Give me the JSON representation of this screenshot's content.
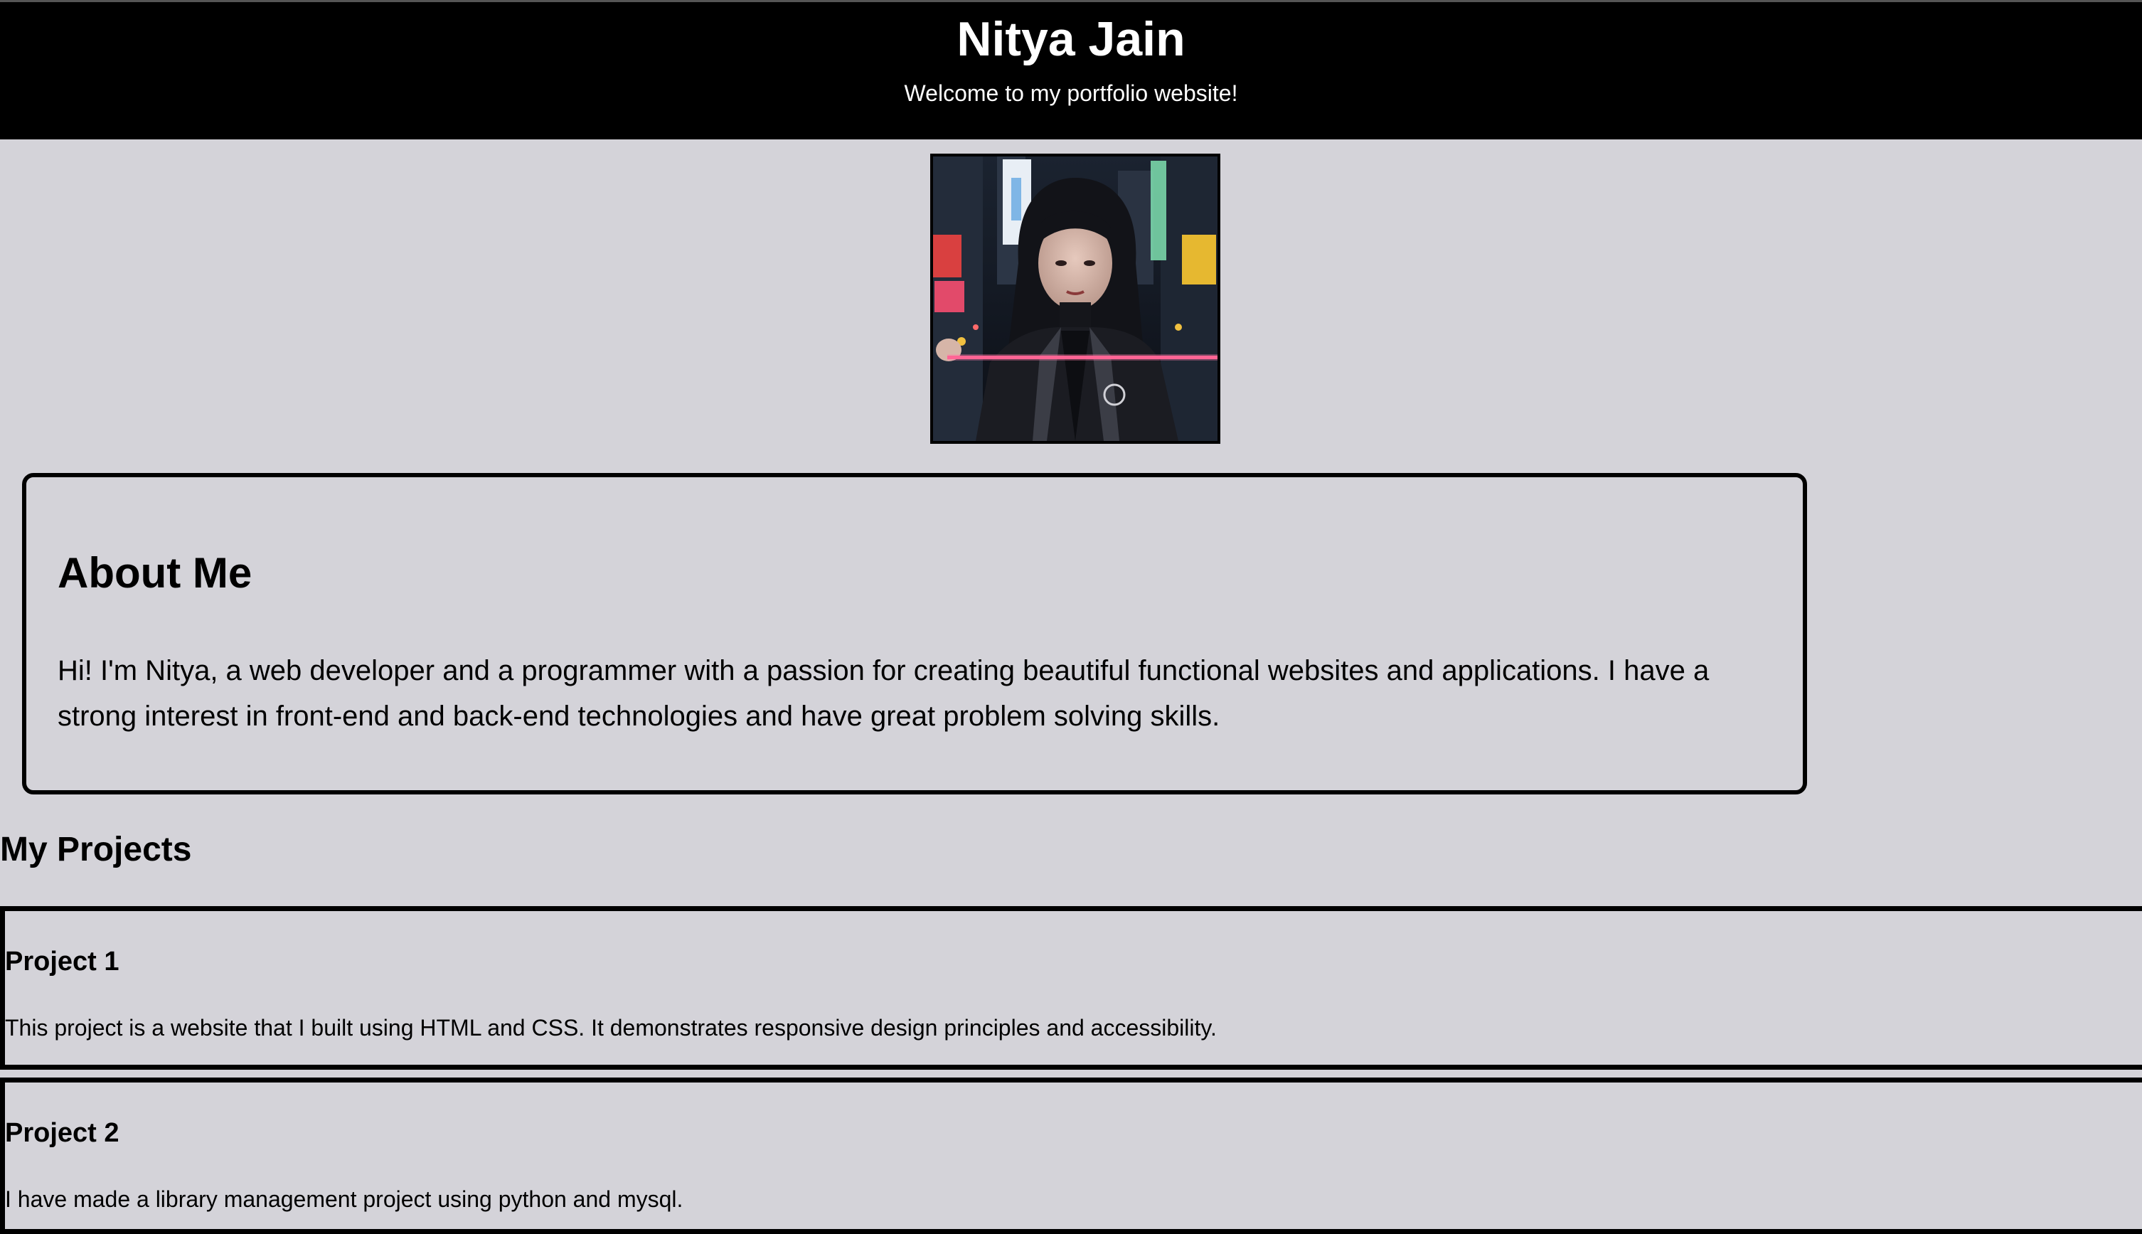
{
  "header": {
    "name": "Nitya Jain",
    "tagline": "Welcome to my portfolio website!"
  },
  "about": {
    "heading": "About Me",
    "text": "Hi! I'm Nitya, a web developer and a programmer with a passion for creating beautiful functional websites and applications. I have a strong interest in front-end and back-end technologies and have great problem solving skills."
  },
  "projects": {
    "heading": "My Projects",
    "items": [
      {
        "title": "Project 1",
        "description": "This project is a website that I built using HTML and CSS. It demonstrates responsive design principles and accessibility."
      },
      {
        "title": "Project 2",
        "description": "I have made a library management project using python and mysql."
      }
    ]
  },
  "colors": {
    "page_background": "#d4d3d9",
    "header_background": "#000000",
    "header_text": "#ffffff",
    "border": "#000000"
  }
}
